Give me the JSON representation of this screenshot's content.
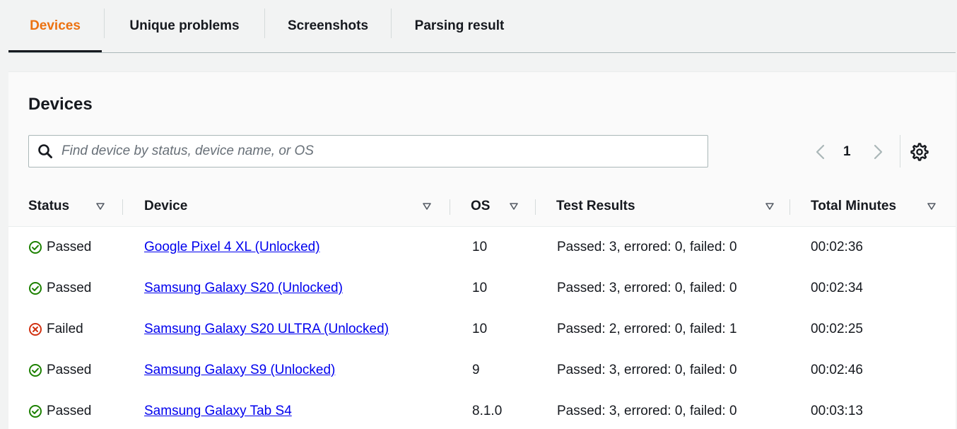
{
  "tabs": [
    {
      "label": "Devices",
      "active": true
    },
    {
      "label": "Unique problems",
      "active": false
    },
    {
      "label": "Screenshots",
      "active": false
    },
    {
      "label": "Parsing result",
      "active": false
    }
  ],
  "panel": {
    "title": "Devices",
    "search_placeholder": "Find device by status, device name, or OS",
    "search_value": "",
    "page_number": "1"
  },
  "columns": [
    "Status",
    "Device",
    "OS",
    "Test Results",
    "Total Minutes"
  ],
  "rows": [
    {
      "status": "Passed",
      "device": "Google Pixel 4 XL (Unlocked)",
      "os": "10",
      "results": "Passed: 3, errored: 0, failed: 0",
      "minutes": "00:02:36"
    },
    {
      "status": "Passed",
      "device": "Samsung Galaxy S20 (Unlocked)",
      "os": "10",
      "results": "Passed: 3, errored: 0, failed: 0",
      "minutes": "00:02:34"
    },
    {
      "status": "Failed",
      "device": "Samsung Galaxy S20 ULTRA (Unlocked)",
      "os": "10",
      "results": "Passed: 2, errored: 0, failed: 1",
      "minutes": "00:02:25"
    },
    {
      "status": "Passed",
      "device": "Samsung Galaxy S9 (Unlocked)",
      "os": "9",
      "results": "Passed: 3, errored: 0, failed: 0",
      "minutes": "00:02:46"
    },
    {
      "status": "Passed",
      "device": "Samsung Galaxy Tab S4",
      "os": "8.1.0",
      "results": "Passed: 3, errored: 0, failed: 0",
      "minutes": "00:03:13"
    }
  ],
  "colors": {
    "active_tab": "#ec7211",
    "passed": "#1d8102",
    "failed": "#d13212",
    "link": "#0000ee"
  },
  "icons": {
    "search": "search-icon",
    "prev": "chevron-left-icon",
    "next": "chevron-right-icon",
    "settings": "gear-icon",
    "sort": "sort-triangle-icon",
    "passed": "check-circle-icon",
    "failed": "x-circle-icon"
  }
}
